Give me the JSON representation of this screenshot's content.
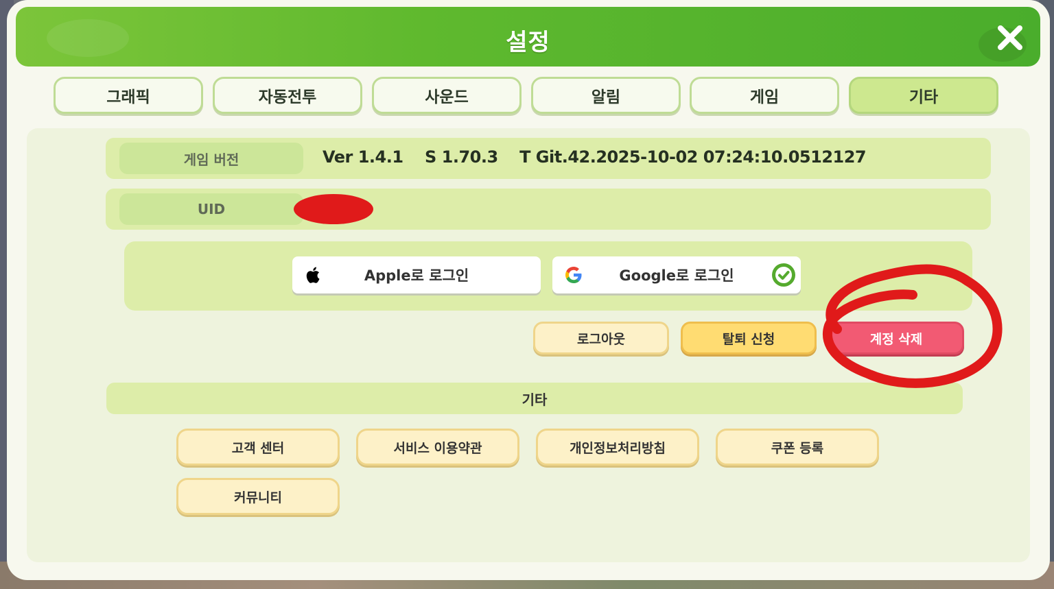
{
  "header": {
    "title": "설정"
  },
  "tabs": [
    {
      "label": "그래픽"
    },
    {
      "label": "자동전투"
    },
    {
      "label": "사운드"
    },
    {
      "label": "알림"
    },
    {
      "label": "게임"
    },
    {
      "label": "기타",
      "active": true
    }
  ],
  "info": {
    "version_label": "게임 버전",
    "version_value": "Ver 1.4.1    S 1.70.3    T Git.42.2025-10-02 07:24:10.0512127",
    "uid_label": "UID"
  },
  "login": {
    "apple_label": "Apple로 로그인",
    "google_label": "Google로 로그인",
    "google_connected": true
  },
  "account_actions": {
    "logout": "로그아웃",
    "withdraw": "탈퇴 신청",
    "delete": "계정 삭제"
  },
  "misc": {
    "section_title": "기타",
    "buttons": [
      "고객 센터",
      "서비스 이용약관",
      "개인정보처리방침",
      "쿠폰 등록",
      "커뮤니티"
    ]
  },
  "colors": {
    "header_green": "#5fb92e",
    "active_tab": "#cde88f",
    "delete_red": "#f25a73",
    "annotation_red": "#e01a1a"
  }
}
